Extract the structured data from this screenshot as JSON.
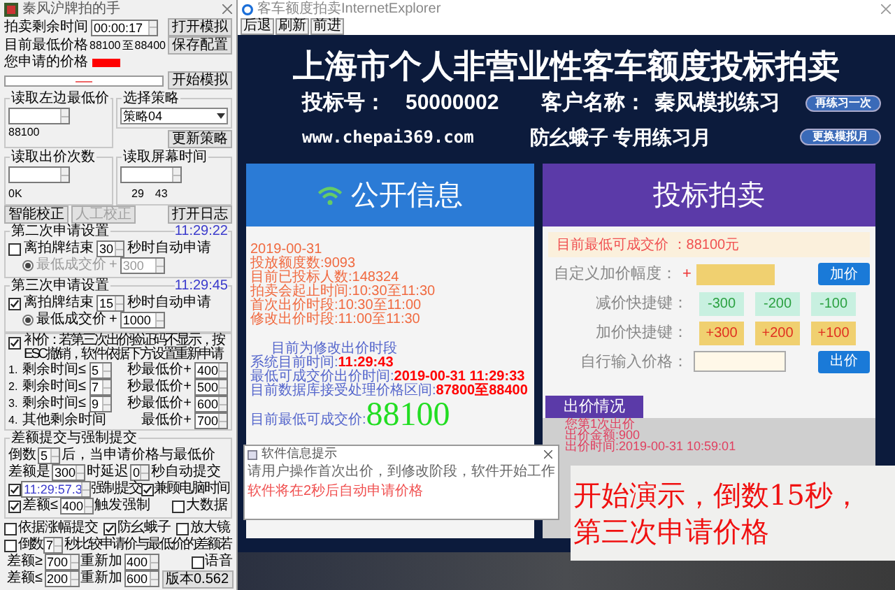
{
  "helper": {
    "title": "秦风沪牌拍的手",
    "remaining_time": {
      "label": "拍卖剩余时间",
      "value": "00:00:17",
      "button": "打开模拟"
    },
    "lowest_price": {
      "label": "目前最低价格",
      "from": "88100",
      "sep": "至",
      "to": "88400",
      "button": "保存配置"
    },
    "your_price": {
      "label": "您申请的价格"
    },
    "start_button": "开始模拟",
    "read_left_price": {
      "legend": "读取左边最低价",
      "reading": "88100"
    },
    "strategy": {
      "legend": "选择策略",
      "value": "策略04",
      "button": "更新策略"
    },
    "read_bid_count": {
      "legend": "读取出价次数",
      "reading": "0K"
    },
    "read_screen_time": {
      "legend": "读取屏幕时间",
      "readings": [
        "29",
        "43"
      ]
    },
    "action_buttons": [
      {
        "label": "智能校正",
        "disabled": false
      },
      {
        "label": "人工校正",
        "disabled": true
      },
      {
        "label": "打开日志",
        "disabled": false
      }
    ],
    "requests": [
      {
        "legend": "第二次申请设置",
        "time": "11:29:22",
        "checked": false,
        "prefix": "离拍牌结束",
        "seconds": "30",
        "suffix": "秒时自动申请",
        "radio_selected": true,
        "radio_label": "最低成交价",
        "plus": "+",
        "amount": "300"
      },
      {
        "legend": "第三次申请设置",
        "time": "11:29:45",
        "checked": true,
        "prefix": "离拍牌结束",
        "seconds": "15",
        "suffix": "秒时自动申请",
        "radio_selected": true,
        "radio_label": "最低成交价",
        "plus": "+",
        "amount": "1000"
      }
    ],
    "supplement": {
      "checked": true,
      "text": "补价：若第三次出价验证码不显示，按ESC撤销，软件依据下方设置重新申请",
      "rules": [
        {
          "kind": "timed",
          "index": "1.",
          "label": "剩余时间≤",
          "seconds": "5",
          "price_label": "秒最低价+",
          "amount": "400"
        },
        {
          "kind": "timed",
          "index": "2.",
          "label": "剩余时间≤",
          "seconds": "7",
          "price_label": "秒最低价+",
          "amount": "500"
        },
        {
          "kind": "timed",
          "index": "3.",
          "label": "剩余时间≤",
          "seconds": "9",
          "price_label": "秒最低价+",
          "amount": "600"
        },
        {
          "kind": "other",
          "index": "4.",
          "label": "其他剩余时间",
          "price_label": "最低价+",
          "amount": "700"
        }
      ]
    },
    "gap_submit": {
      "legend": "差额提交与强制提交",
      "countdown_label": "倒数",
      "countdown": "5",
      "countdown_suffix": "后，当申请价格与最低价",
      "gap_label": "差额是",
      "gap": "300",
      "delay_label": "时延迟",
      "delay": "0",
      "delay_suffix": "秒自动提交",
      "force": {
        "checked": true,
        "time": "11:29:57.3",
        "label": "强制提交"
      },
      "computer_time": {
        "checked": true,
        "label": "兼顾电脑时间"
      },
      "gap_trigger": {
        "checked": true,
        "label": "差额≤",
        "value": "400",
        "suffix": "触发强制"
      },
      "big_data": {
        "checked": false,
        "label": "大数据"
      }
    },
    "options": [
      {
        "label": "依据涨幅提交",
        "checked": false
      },
      {
        "label": "防幺蛾子",
        "checked": true
      },
      {
        "label": "放大镜",
        "checked": false
      }
    ],
    "recheck": {
      "checked": false,
      "label": "倒数",
      "seconds": "7",
      "suffix": "秒比较申请价与最低价的差额若",
      "rows": [
        {
          "label": "差额≥",
          "gap": "700",
          "add_label": "重新加",
          "add": "400"
        },
        {
          "label": "差额≤",
          "gap": "200",
          "add_label": "重新加",
          "add": "600"
        }
      ]
    },
    "voice": {
      "checked": false,
      "label": "语音"
    },
    "version_button": "版本0.562"
  },
  "browser": {
    "title": "客车额度拍卖InternetExplorer",
    "toolbar": [
      "后退",
      "刷新",
      "前进"
    ],
    "page": {
      "heading": "上海市个人非营业性客车额度投标拍卖",
      "bid_number": {
        "label": "投标号：",
        "value": "50000002"
      },
      "customer": {
        "label": "客户名称：",
        "value": "秦风模拟练习"
      },
      "site": "www.chepai369.com",
      "tagline": "防幺蛾子 专用练习月",
      "buttons": [
        "再练习一次",
        "更换模拟月"
      ],
      "public_info": {
        "title": "公开信息",
        "lines": [
          "2019-00-31",
          "投放额度数:9093",
          "目前已投标人数:148324",
          "拍卖会起止时间:10:30至11:30",
          "首次出价时段:10:30至11:00",
          "修改出价时段:11:00至11:30"
        ],
        "phase": "目前为修改出价时段",
        "status": [
          {
            "label": "系统目前时间:",
            "value": "11:29:43"
          },
          {
            "label": "最低可成交价出价时间:",
            "value": "2019-00-31 11:29:33"
          },
          {
            "label": "目前数据库接受处理价格区间:",
            "value": "87800至88400"
          }
        ],
        "lowest": {
          "label": "目前最低可成交价:",
          "value": "88100"
        }
      },
      "bidding": {
        "title": "投标拍卖",
        "notice": "目前最低可成交价 ：88100元",
        "custom_label": "自定义加价幅度：",
        "plus": "+",
        "raise_button": "加价",
        "decrease_label": "减价快捷键：",
        "decrease_keys": [
          "-300",
          "-200",
          "-100"
        ],
        "increase_label": "加价快捷键：",
        "increase_keys": [
          "+300",
          "+200",
          "+100"
        ],
        "manual_label": "自行输入价格：",
        "bid_button": "出价"
      },
      "bid_status": {
        "title": "出价情况",
        "lines": [
          "您第1次出价",
          "出价金额:900",
          "出价时间:2019-00-31 10:59:01"
        ]
      }
    }
  },
  "popup": {
    "title": "软件信息提示",
    "message": "请用户操作首次出价，到修改阶段，软件开始工作",
    "notice": "软件将在2秒后自动申请价格"
  },
  "caption": [
    "开始演示，倒数15秒，",
    "第三次申请价格"
  ]
}
